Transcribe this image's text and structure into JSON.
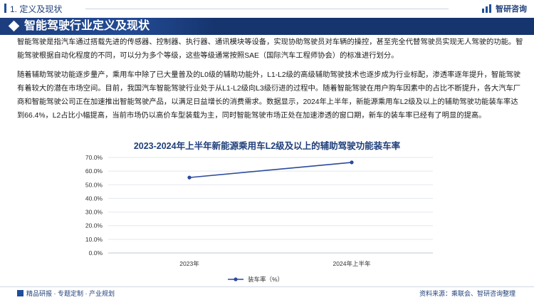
{
  "header": {
    "section": "1. 定义及现状",
    "logo_text": "智研咨询"
  },
  "banner": {
    "title": "智能驾驶行业定义及现状"
  },
  "paragraphs": {
    "p1": "智能驾驶是指汽车通过搭载先进的传感器、控制器、执行器、通讯模块等设备，实现协助驾驶员对车辆的操控，甚至完全代替驾驶员实现无人驾驶的功能。智能驾驶根据自动化程度的不同，可以分为多个等级，这些等级通常按照SAE（国际汽车工程师协会）的标准进行划分。",
    "p2": "随着辅助驾驶功能逐步量产，乘用车中除了已大量普及的L0级的辅助功能外，L1-L2级的高级辅助驾驶技术也逐步成为行业标配，渗透率逐年提升，智能驾驶有着较大的潜在市场空间。目前，我国汽车智能驾驶行业处于从L1-L2级向L3级衍进的过程中。随着智能驾驶在用户购车因素中的占比不断提升，各大汽车厂商和智能驾驶公司正在加速推出智能驾驶产品，以满足日益增长的消费需求。数据显示，2024年上半年，新能源乘用车L2级及以上的辅助驾驶功能装车率达到66.4%，L2占比小幅提高，当前市场仍以高价车型装载为主，同时智能驾驶市场正处在加速渗透的窗口期，新车的装车率已经有了明显的提高。"
  },
  "chart_data": {
    "type": "line",
    "title": "2023-2024年上半年新能源乘用车L2级及以上的辅助驾驶功能装车率",
    "categories": [
      "2023年",
      "2024年上半年"
    ],
    "series": [
      {
        "name": "装车率（%）",
        "values": [
          55.3,
          66.4
        ],
        "color": "#2c4a9c"
      }
    ],
    "ylim": [
      0,
      70
    ],
    "yticks": [
      "0.0%",
      "10.0%",
      "20.0%",
      "30.0%",
      "40.0%",
      "50.0%",
      "60.0%",
      "70.0%"
    ],
    "grid": true,
    "legend": "bottom"
  },
  "footer": {
    "left": "精品研报 · 专题定制 · 产业规划",
    "right": "资料来源：乘联会、智研咨询整理"
  },
  "colors": {
    "primary": "#16356f",
    "accent": "#1f4e9a",
    "series": "#2c4a9c"
  }
}
